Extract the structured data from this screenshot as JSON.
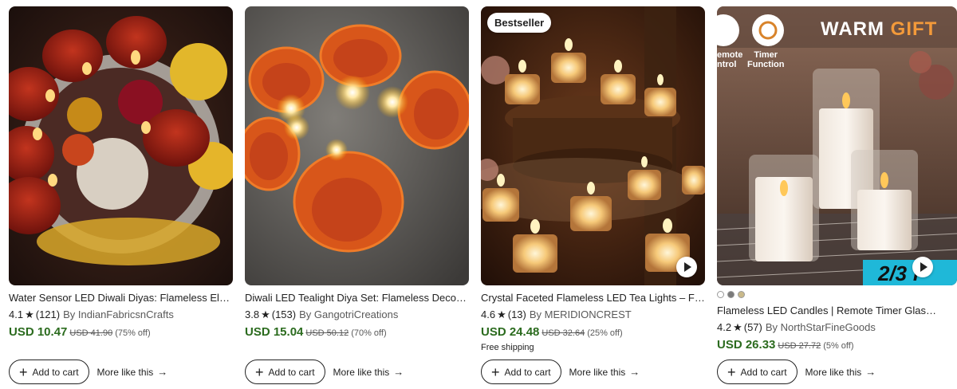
{
  "cards": [
    {
      "title": "Water Sensor LED Diwali Diyas: Flameless Electric Tealights for Festive Decor",
      "rating": "4.1",
      "reviews": "(121)",
      "shop": "By IndianFabricsnCrafts",
      "price": "USD 10.47",
      "original": "USD 41.90",
      "discount": "(75% off)",
      "add_label": "Add to cart",
      "more_label": "More like this"
    },
    {
      "title": "Diwali LED Tealight Diya Set: Flameless Decorative Lamps",
      "rating": "3.8",
      "reviews": "(153)",
      "shop": "By GangotriCreations",
      "price": "USD 15.04",
      "original": "USD 50.12",
      "discount": "(70% off)",
      "add_label": "Add to cart",
      "more_label": "More like this"
    },
    {
      "badge": "Bestseller",
      "title": "Crystal Faceted Flameless LED Tea Lights – Flickering",
      "rating": "4.6",
      "reviews": "(13)",
      "shop": "By MERIDIONCREST",
      "price": "USD 24.48",
      "original": "USD 32.64",
      "discount": "(25% off)",
      "shipping": "Free shipping",
      "add_label": "Add to cart",
      "more_label": "More like this"
    },
    {
      "overlay_top": "WARM",
      "overlay_top_accent": "GIFT",
      "overlay_remote": "emote\nntrol",
      "overlay_timer": "Timer\nFunction",
      "overlay_page": "2/3 f",
      "title": "Flameless LED Candles | Remote Timer Glass Pillar Candles",
      "rating": "4.2",
      "reviews": "(57)",
      "shop": "By NorthStarFineGoods",
      "price": "USD 26.33",
      "original": "USD 27.72",
      "discount": "(5% off)",
      "swatches": [
        "#ffffff",
        "#7a7a7a",
        "#c9b98a"
      ],
      "add_label": "Add to cart",
      "more_label": "More like this"
    }
  ]
}
